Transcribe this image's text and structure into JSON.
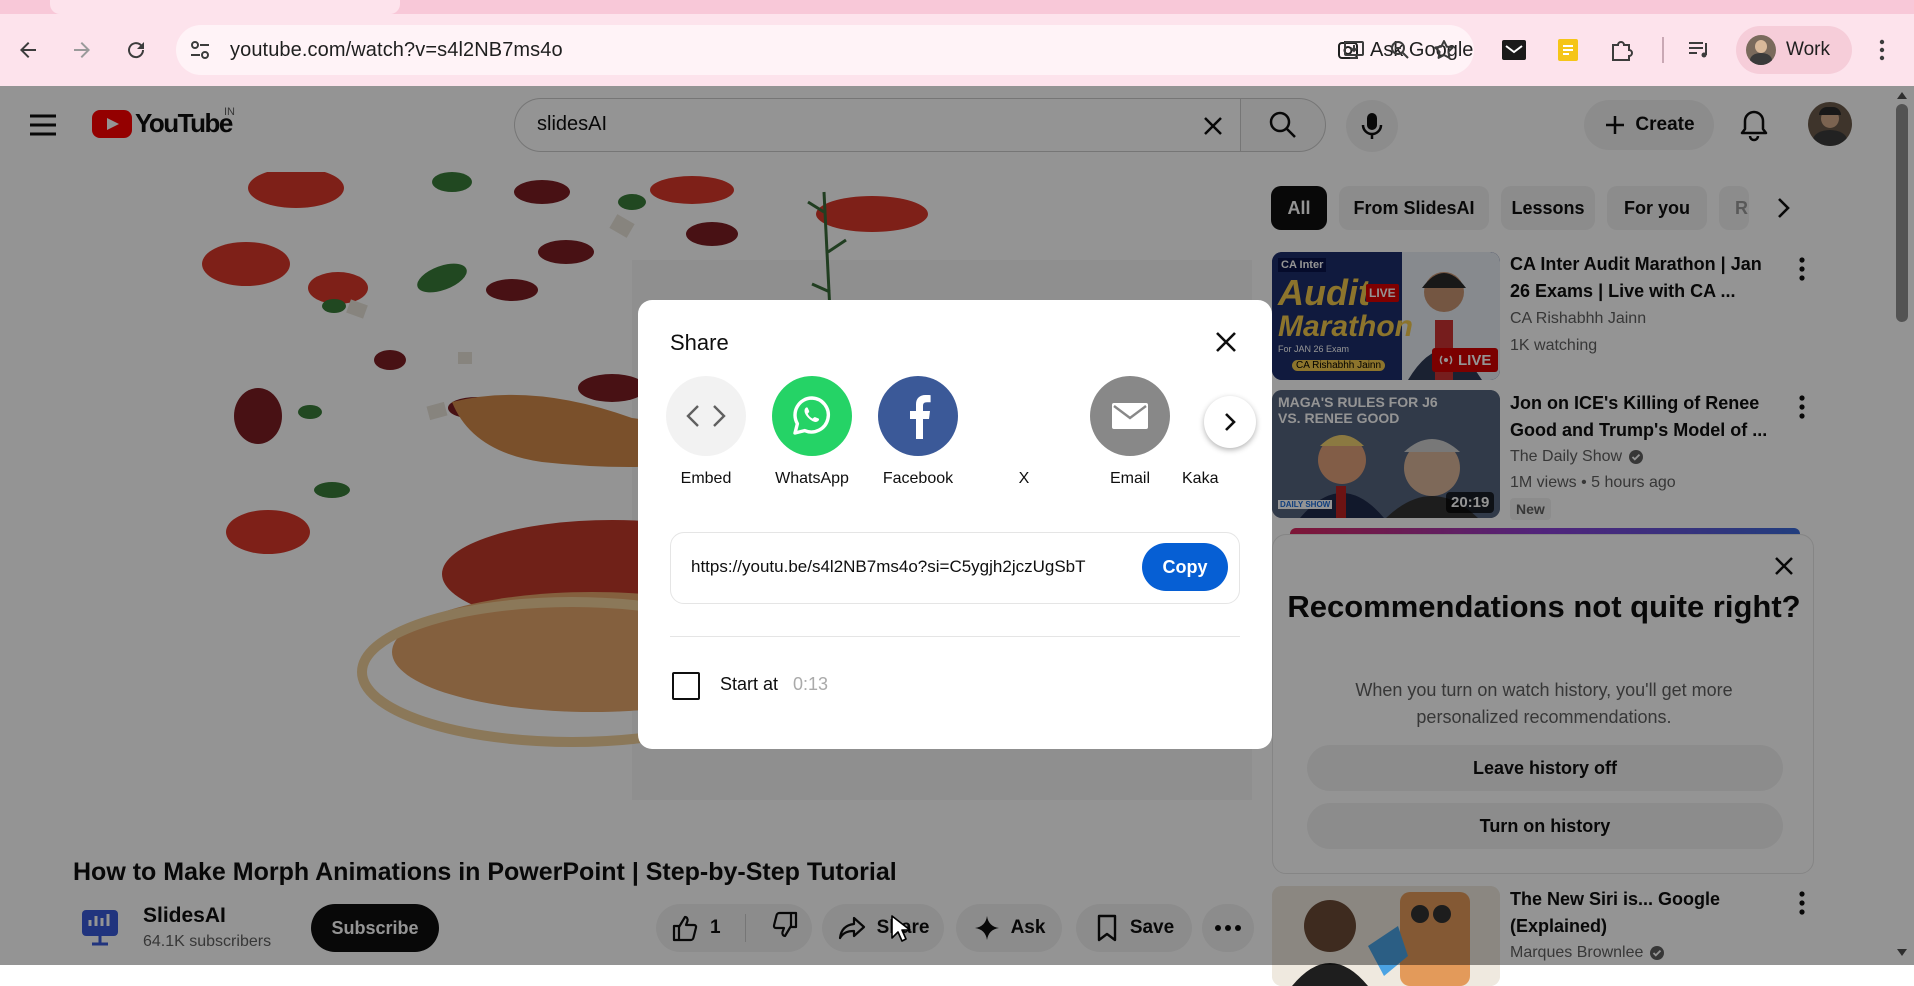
{
  "browser": {
    "url": "youtube.com/watch?v=s4l2NB7ms4o",
    "ask_google": "Ask Google",
    "profile": "Work"
  },
  "header": {
    "logo_text": "YouTube",
    "country_code": "IN",
    "search_value": "slidesAI",
    "create_label": "Create"
  },
  "video": {
    "title": "How to Make Morph Animations in PowerPoint | Step-by-Step Tutorial",
    "channel_name": "SlidesAI",
    "channel_subs": "64.1K subscribers",
    "subscribe_label": "Subscribe",
    "like_count": "1",
    "share_label": "Share",
    "ask_label": "Ask",
    "save_label": "Save"
  },
  "sidebar": {
    "chips": [
      "All",
      "From SlidesAI",
      "Lessons",
      "For you",
      "R"
    ],
    "recs": [
      {
        "title": "CA Inter Audit Marathon | Jan 26 Exams | Live with CA ...",
        "channel": "CA Rishabhh Jainn",
        "meta": "1K watching",
        "badge": "LIVE",
        "thumb_text": [
          "CA Inter",
          "Audit",
          "LIVE",
          "Marathon",
          "For JAN 26 Exam",
          "CA Rishabhh Jainn"
        ]
      },
      {
        "title": "Jon on ICE's Killing of Renee Good and Trump's Model of ...",
        "channel": "The Daily Show",
        "meta": "1M views • 5 hours ago",
        "badge": "20:19",
        "new_label": "New",
        "thumb_text": [
          "MAGA'S RULES FOR J6",
          "VS. RENEE GOOD",
          "DAILY SHOW"
        ]
      },
      {
        "title": "The New Siri is... Google (Explained)",
        "channel": "Marques Brownlee"
      }
    ],
    "reco_card": {
      "heading": "Recommendations not quite right?",
      "body": "When you turn on watch history, you'll get more personalized recommendations.",
      "btn_off": "Leave history off",
      "btn_on": "Turn on history"
    }
  },
  "share_dialog": {
    "title": "Share",
    "targets": [
      "Embed",
      "WhatsApp",
      "Facebook",
      "X",
      "Email",
      "Kaka"
    ],
    "link": "https://youtu.be/s4l2NB7ms4o?si=C5ygjh2jczUgSbT",
    "copy_label": "Copy",
    "start_at_label": "Start at",
    "start_time": "0:13"
  },
  "colors": {
    "youtube_red": "#ff0000",
    "whatsapp": "#25d366",
    "facebook": "#3b5998",
    "email": "#888888",
    "copy_blue": "#065fd4"
  }
}
